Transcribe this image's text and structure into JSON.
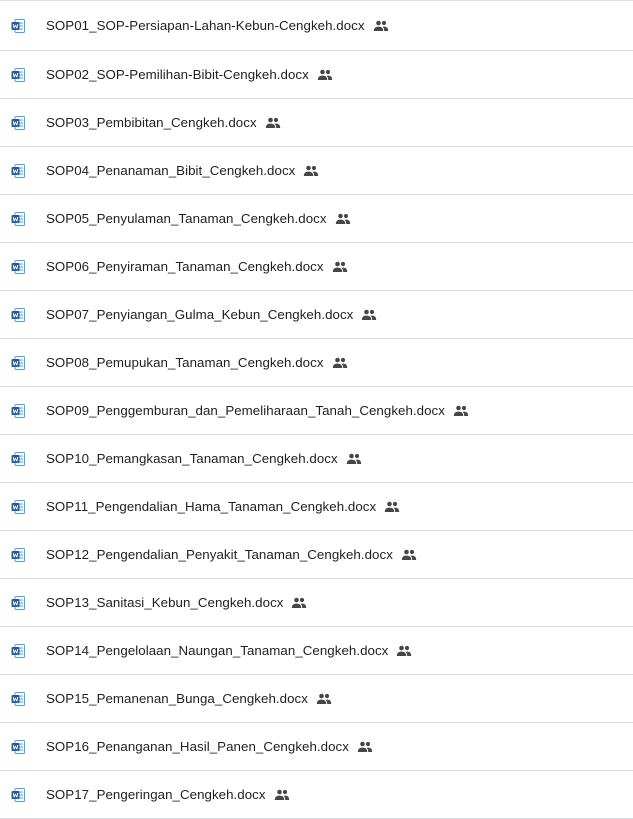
{
  "files": [
    {
      "name": "SOP01_SOP-Persiapan-Lahan-Kebun-Cengkeh.docx",
      "icon": "word-doc-icon",
      "shared_icon": "shared-people-icon"
    },
    {
      "name": "SOP02_SOP-Pemilihan-Bibit-Cengkeh.docx",
      "icon": "word-doc-icon",
      "shared_icon": "shared-people-icon"
    },
    {
      "name": "SOP03_Pembibitan_Cengkeh.docx",
      "icon": "word-doc-icon",
      "shared_icon": "shared-people-icon"
    },
    {
      "name": "SOP04_Penanaman_Bibit_Cengkeh.docx",
      "icon": "word-doc-icon",
      "shared_icon": "shared-people-icon"
    },
    {
      "name": "SOP05_Penyulaman_Tanaman_Cengkeh.docx",
      "icon": "word-doc-icon",
      "shared_icon": "shared-people-icon"
    },
    {
      "name": "SOP06_Penyiraman_Tanaman_Cengkeh.docx",
      "icon": "word-doc-icon",
      "shared_icon": "shared-people-icon"
    },
    {
      "name": "SOP07_Penyiangan_Gulma_Kebun_Cengkeh.docx",
      "icon": "word-doc-icon",
      "shared_icon": "shared-people-icon"
    },
    {
      "name": "SOP08_Pemupukan_Tanaman_Cengkeh.docx",
      "icon": "word-doc-icon",
      "shared_icon": "shared-people-icon"
    },
    {
      "name": "SOP09_Penggemburan_dan_Pemeliharaan_Tanah_Cengkeh.docx",
      "icon": "word-doc-icon",
      "shared_icon": "shared-people-icon"
    },
    {
      "name": "SOP10_Pemangkasan_Tanaman_Cengkeh.docx",
      "icon": "word-doc-icon",
      "shared_icon": "shared-people-icon"
    },
    {
      "name": "SOP11_Pengendalian_Hama_Tanaman_Cengkeh.docx",
      "icon": "word-doc-icon",
      "shared_icon": "shared-people-icon"
    },
    {
      "name": "SOP12_Pengendalian_Penyakit_Tanaman_Cengkeh.docx",
      "icon": "word-doc-icon",
      "shared_icon": "shared-people-icon"
    },
    {
      "name": "SOP13_Sanitasi_Kebun_Cengkeh.docx",
      "icon": "word-doc-icon",
      "shared_icon": "shared-people-icon"
    },
    {
      "name": "SOP14_Pengelolaan_Naungan_Tanaman_Cengkeh.docx",
      "icon": "word-doc-icon",
      "shared_icon": "shared-people-icon"
    },
    {
      "name": "SOP15_Pemanenan_Bunga_Cengkeh.docx",
      "icon": "word-doc-icon",
      "shared_icon": "shared-people-icon"
    },
    {
      "name": "SOP16_Penanganan_Hasil_Panen_Cengkeh.docx",
      "icon": "word-doc-icon",
      "shared_icon": "shared-people-icon"
    },
    {
      "name": "SOP17_Pengeringan_Cengkeh.docx",
      "icon": "word-doc-icon",
      "shared_icon": "shared-people-icon"
    }
  ],
  "colors": {
    "word_blue": "#2b579a",
    "word_light": "#41a5ee",
    "shared_icon": "#444746",
    "divider": "#dadce0",
    "text": "#1f1f1f"
  }
}
